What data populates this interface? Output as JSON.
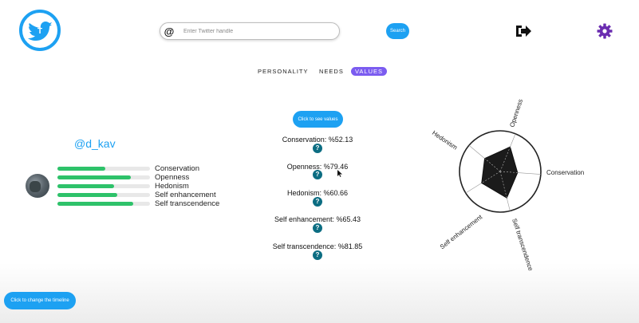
{
  "header": {
    "search_prefix": "@",
    "search_placeholder": "Enter Twitter handle",
    "search_button": "Search",
    "logout_icon": "sign-out-icon",
    "settings_icon": "gear-icon",
    "logo_icon": "twitter-bird-icon",
    "accent_color": "#1da1f2",
    "settings_color": "#6a2cb0"
  },
  "tabs": [
    {
      "label": "PERSONALITY",
      "active": false
    },
    {
      "label": "NEEDS",
      "active": false
    },
    {
      "label": "VALUES",
      "active": true,
      "color": "#7b5cf0"
    }
  ],
  "profile": {
    "handle": "@d_kav",
    "bar_color": "#2ec26a",
    "traits": [
      {
        "label": "Conservation",
        "level": 0.52
      },
      {
        "label": "Openness",
        "level": 0.79
      },
      {
        "label": "Hedonism",
        "level": 0.61
      },
      {
        "label": "Self enhancement",
        "level": 0.65
      },
      {
        "label": "Self transcendence",
        "level": 0.82
      }
    ]
  },
  "scores": {
    "see_values_button": "Click to see values",
    "items": [
      {
        "text": "Conservation: %52.13"
      },
      {
        "text": "Openness: %79.46"
      },
      {
        "text": "Hedonism: %60.66"
      },
      {
        "text": "Self enhancement: %65.43"
      },
      {
        "text": "Self transcendence: %81.85"
      }
    ],
    "help_icon": "question-circle-icon",
    "help_glyph": "?",
    "help_color": "#0c6d82"
  },
  "radar": {
    "axes": [
      {
        "label": "Conservation",
        "value": 52.13
      },
      {
        "label": "Self transcendence",
        "value": 81.85
      },
      {
        "label": "Self enhancement",
        "value": 65.43
      },
      {
        "label": "Hedonism",
        "value": 60.66
      },
      {
        "label": "Openness",
        "value": 79.46
      }
    ],
    "max": 100
  },
  "footer": {
    "timeline_button": "Click to change the timeline"
  }
}
